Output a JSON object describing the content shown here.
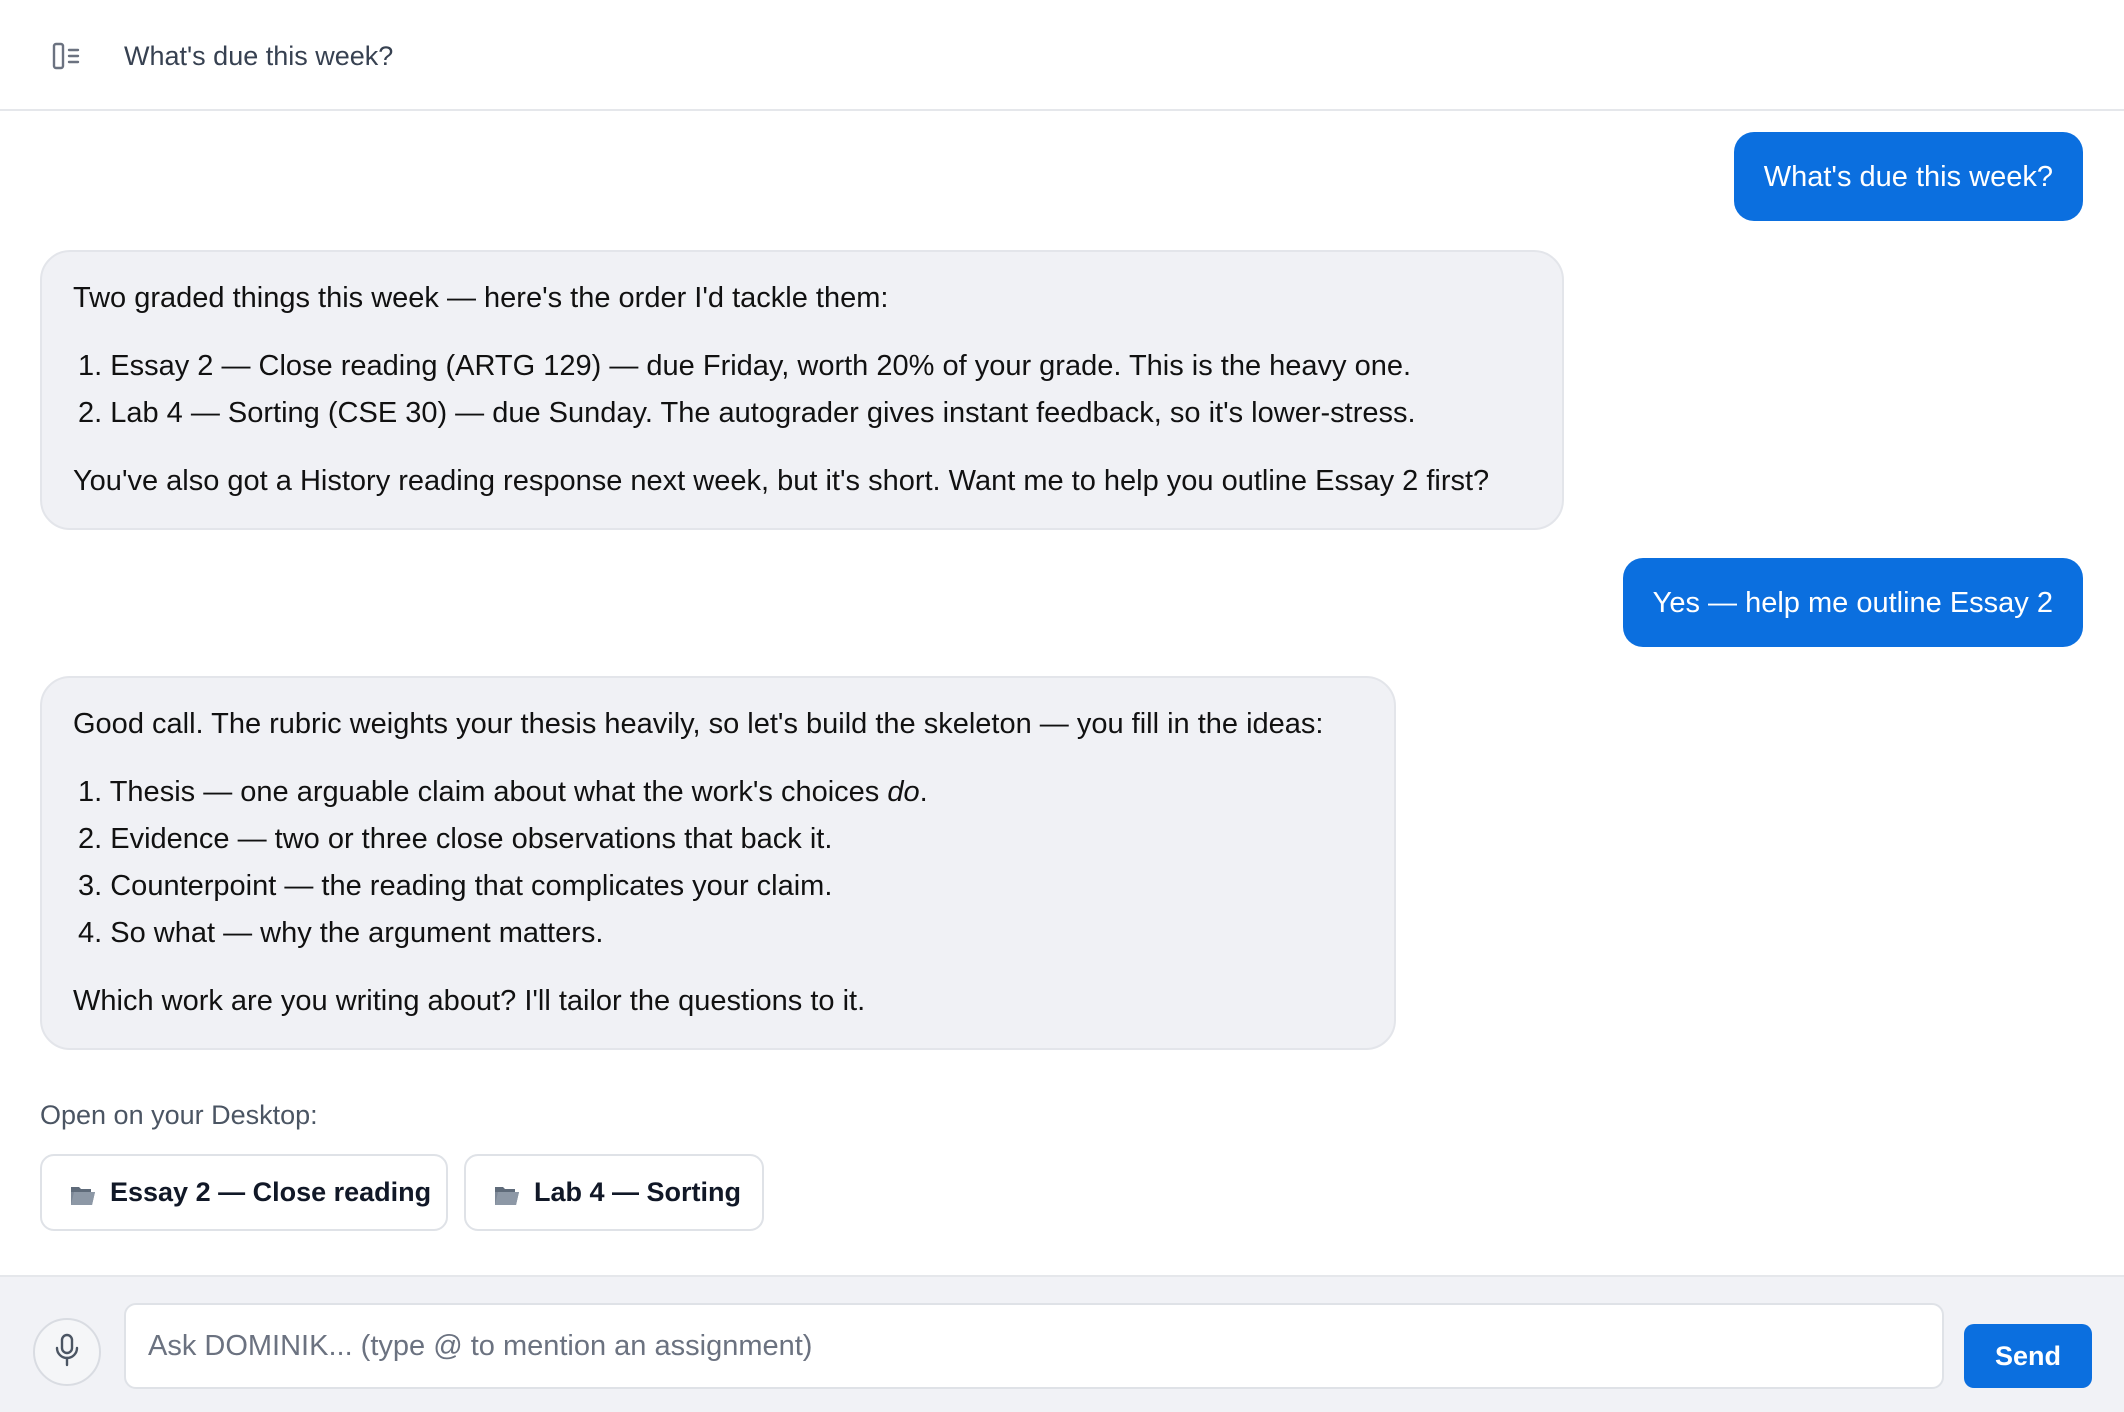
{
  "header": {
    "title": "What's due this week?",
    "sidebar_toggle_icon": "sidebar-toggle-icon"
  },
  "messages": [
    {
      "role": "user",
      "text": "What's due this week?"
    },
    {
      "role": "assistant",
      "intro": "Two graded things this week — here's the order I'd tackle them:",
      "items": [
        "1. Essay 2 — Close reading (ARTG 129) — due Friday, worth 20% of your grade. This is the heavy one.",
        "2. Lab 4 — Sorting (CSE 30) — due Sunday. The autograder gives instant feedback, so it's lower-stress."
      ],
      "outro": "You've also got a History reading response next week, but it's short. Want me to help you outline Essay 2 first?"
    },
    {
      "role": "user",
      "text": "Yes — help me outline Essay 2"
    },
    {
      "role": "assistant",
      "intro": "Good call. The rubric weights your thesis heavily, so let's build the skeleton — you fill in the ideas:",
      "items": [
        {
          "before": "1. Thesis — one arguable claim about what the work's choices ",
          "em": "do",
          "after": "."
        },
        "2. Evidence — two or three close observations that back it.",
        "3. Counterpoint — the reading that complicates your claim.",
        "4. So what — why the argument matters."
      ],
      "outro": "Which work are you writing about? I'll tailor the questions to it."
    }
  ],
  "desktop": {
    "label": "Open on your Desktop:",
    "buttons": [
      {
        "icon": "folder-icon",
        "label": "Essay 2 — Close reading"
      },
      {
        "icon": "folder-icon",
        "label": "Lab 4 — Sorting"
      }
    ]
  },
  "composer": {
    "mic_icon": "microphone-icon",
    "input_value": "",
    "placeholder": "Ask DOMINIK... (type @ to mention an assignment)",
    "send_label": "Send"
  },
  "colors": {
    "accent": "#0b6fdf",
    "assistant_bubble": "#f0f1f5",
    "composer_bg": "#f1f2f6"
  }
}
